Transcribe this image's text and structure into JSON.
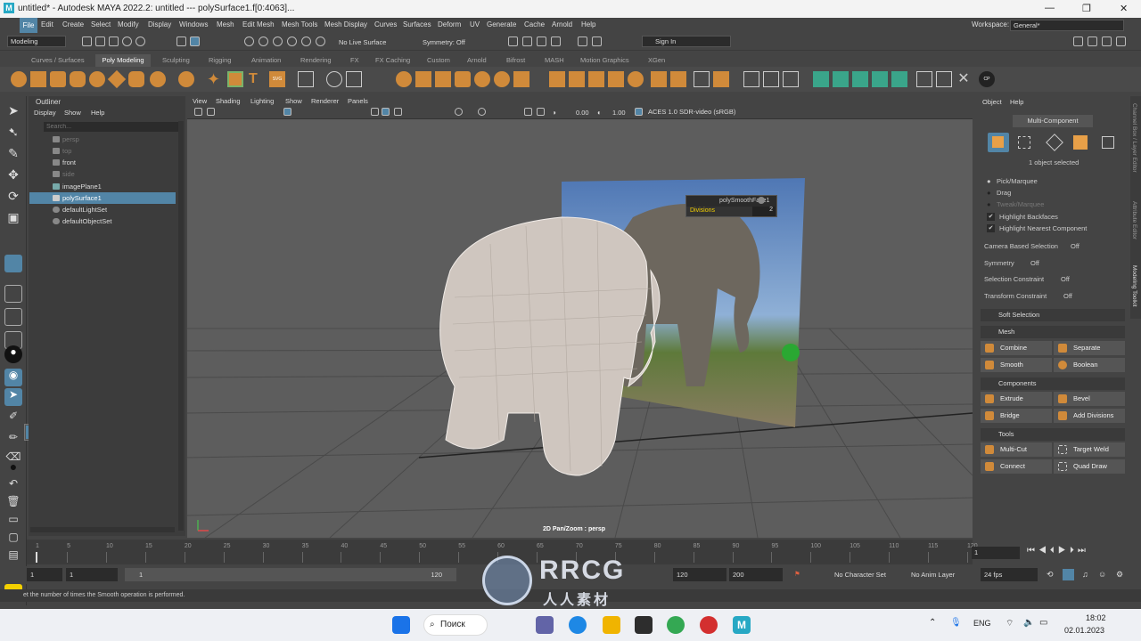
{
  "window": {
    "title": "untitled* - Autodesk MAYA 2022.2: untitled   ---   polySurface1.f[0:4063]...",
    "app_icon": "M"
  },
  "menubar": {
    "items": [
      "File",
      "Edit",
      "Create",
      "Select",
      "Modify",
      "Display",
      "Windows",
      "Mesh",
      "Edit Mesh",
      "Mesh Tools",
      "Mesh Display",
      "Curves",
      "Surfaces",
      "Deform",
      "UV",
      "Generate",
      "Cache",
      "Arnold",
      "Help"
    ],
    "workspace_label": "Workspace:",
    "workspace_value": "General*"
  },
  "statusline": {
    "mode": "Modeling",
    "live_surface": "No Live Surface",
    "symmetry": "Symmetry: Off",
    "sign_in": "Sign In"
  },
  "shelf": {
    "tabs": [
      "Curves / Surfaces",
      "Poly Modeling",
      "Sculpting",
      "Rigging",
      "Animation",
      "Rendering",
      "FX",
      "FX Caching",
      "Custom",
      "Arnold",
      "Bifrost",
      "MASH",
      "Motion Graphics",
      "XGen"
    ],
    "active_tab": "Poly Modeling"
  },
  "outliner": {
    "title": "Outliner",
    "menu": [
      "Display",
      "Show",
      "Help"
    ],
    "search_placeholder": "Search...",
    "items": [
      {
        "label": "persp",
        "dim": true
      },
      {
        "label": "top",
        "dim": true
      },
      {
        "label": "front",
        "dim": false
      },
      {
        "label": "side",
        "dim": true
      },
      {
        "label": "imagePlane1",
        "dim": false
      },
      {
        "label": "polySurface1",
        "dim": false,
        "selected": true
      },
      {
        "label": "defaultLightSet",
        "dim": false
      },
      {
        "label": "defaultObjectSet",
        "dim": false
      }
    ]
  },
  "viewport": {
    "menu": [
      "View",
      "Shading",
      "Lighting",
      "Show",
      "Renderer",
      "Panels"
    ],
    "exposure": "0.00",
    "gamma": "1.00",
    "colorspace": "ACES 1.0 SDR-video (sRGB)",
    "camera_label": "2D Pan/Zoom : persp",
    "tooltip": {
      "node": "polySmoothFace1",
      "attr": "Divisions",
      "value": "2"
    }
  },
  "attribute_panel": {
    "menu": [
      "Object",
      "Help"
    ],
    "mode": "Multi-Component",
    "selection_info": "1 object selected",
    "options": [
      {
        "label": "Pick/Marquee",
        "on": true
      },
      {
        "label": "Drag",
        "on": false
      },
      {
        "label": "Tweak/Marquee",
        "on": false
      }
    ],
    "checks": [
      "Highlight Backfaces",
      "Highlight Nearest Component"
    ],
    "settings": [
      {
        "label": "Camera Based Selection",
        "value": "Off"
      },
      {
        "label": "Symmetry",
        "value": "Off"
      },
      {
        "label": "Selection Constraint",
        "value": "Off"
      },
      {
        "label": "Transform Constraint",
        "value": "Off"
      }
    ],
    "soft_selection": "Soft Selection",
    "sections": [
      {
        "title": "Mesh",
        "buttons": [
          "Combine",
          "Separate",
          "Smooth",
          "Boolean"
        ]
      },
      {
        "title": "Components",
        "buttons": [
          "Extrude",
          "Bevel",
          "Bridge",
          "Add Divisions"
        ]
      },
      {
        "title": "Tools",
        "buttons": [
          "Multi-Cut",
          "Target Weld",
          "Connect",
          "Quad Draw"
        ]
      }
    ]
  },
  "side_tabs": [
    "Channel Box / Layer Editor",
    "Attribute Editor",
    "Modeling Toolkit"
  ],
  "timeslider": {
    "ticks": [
      "1",
      "5",
      "10",
      "15",
      "20",
      "25",
      "30",
      "35",
      "40",
      "45",
      "50",
      "55",
      "60",
      "65",
      "70",
      "75",
      "80",
      "85",
      "90",
      "95",
      "100",
      "105",
      "110",
      "115",
      "120"
    ],
    "current": "1"
  },
  "range": {
    "start": "1",
    "inner_start": "1",
    "inner_end": "120",
    "end": "120",
    "max": "200",
    "character_set": "No Character Set",
    "anim_layer": "No Anim Layer",
    "fps": "24 fps"
  },
  "helpline": "et the number of times the Smooth operation is performed.",
  "taskbar": {
    "search": "Поиск",
    "lang": "ENG",
    "time": "18:02",
    "date": "02.01.2023"
  },
  "watermark": {
    "text": "RRCG",
    "subtext": "人人素材"
  },
  "colors": {
    "accent": "#5285a6",
    "maya_icon": "#27a8c4",
    "shelf_orange": "#d08a3a"
  }
}
